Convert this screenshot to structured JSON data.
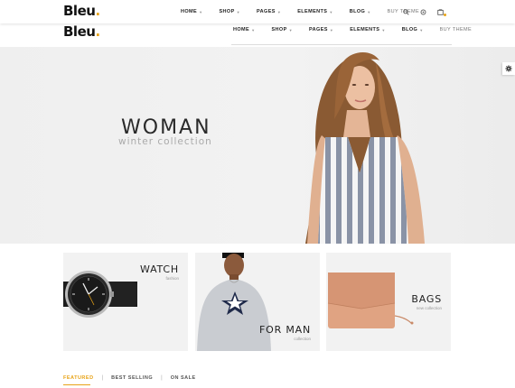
{
  "brand": {
    "name": "Bleu",
    "dot": "."
  },
  "nav": {
    "items": [
      {
        "label": "HOME"
      },
      {
        "label": "SHOP"
      },
      {
        "label": "PAGES"
      },
      {
        "label": "ELEMENTS"
      },
      {
        "label": "BLOG"
      },
      {
        "label": "BUY THEME"
      }
    ]
  },
  "header_icons": [
    "search-icon",
    "settings-icon",
    "cart-icon"
  ],
  "hero": {
    "title": "WOMAN",
    "subtitle": "winter collection"
  },
  "cards": [
    {
      "title": "WATCH",
      "subtitle": "fashion"
    },
    {
      "title": "FOR MAN",
      "subtitle": "collection"
    },
    {
      "title": "BAGS",
      "subtitle": "new collection"
    }
  ],
  "tabs": [
    {
      "label": "FEATURED"
    },
    {
      "label": "BEST SELLING"
    },
    {
      "label": "ON SALE"
    }
  ],
  "separator": "|",
  "colors": {
    "accent": "#e8a317",
    "text": "#222222",
    "muted": "#999999"
  }
}
